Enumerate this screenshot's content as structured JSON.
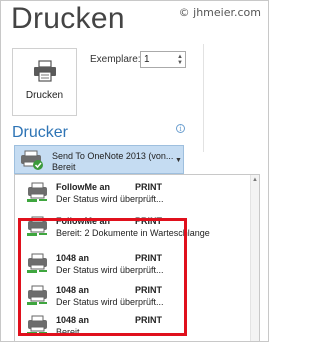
{
  "header": {
    "title": "Drucken",
    "watermark": "© jhmeier.com"
  },
  "print_action": {
    "label": "Drucken",
    "icon": "printer-icon"
  },
  "copies": {
    "label": "Exemplare:",
    "value": "1"
  },
  "printer_section": {
    "title": "Drucker",
    "info_icon": "info-icon"
  },
  "selected_printer": {
    "name": "Send To OneNote 2013 (von...",
    "status": "Bereit",
    "icon": "printer-check-icon"
  },
  "printer_list": [
    {
      "name": "FollowMe an",
      "type": "PRINT",
      "status": "Der Status wird überprüft..."
    },
    {
      "name": "FollowMe an",
      "type": "PRINT",
      "status": "Bereit: 2 Dokumente in Warteschlange"
    },
    {
      "name": "1048 an",
      "type": "PRINT",
      "status": "Der Status wird überprüft..."
    },
    {
      "name": "1048 an",
      "type": "PRINT",
      "status": "Der Status wird überprüft..."
    },
    {
      "name": "1048 an",
      "type": "PRINT",
      "status": "Bereit"
    }
  ],
  "colors": {
    "accent": "#2e74b5",
    "selected_bg": "#c5dcf2",
    "highlight_border": "#e0101c"
  }
}
